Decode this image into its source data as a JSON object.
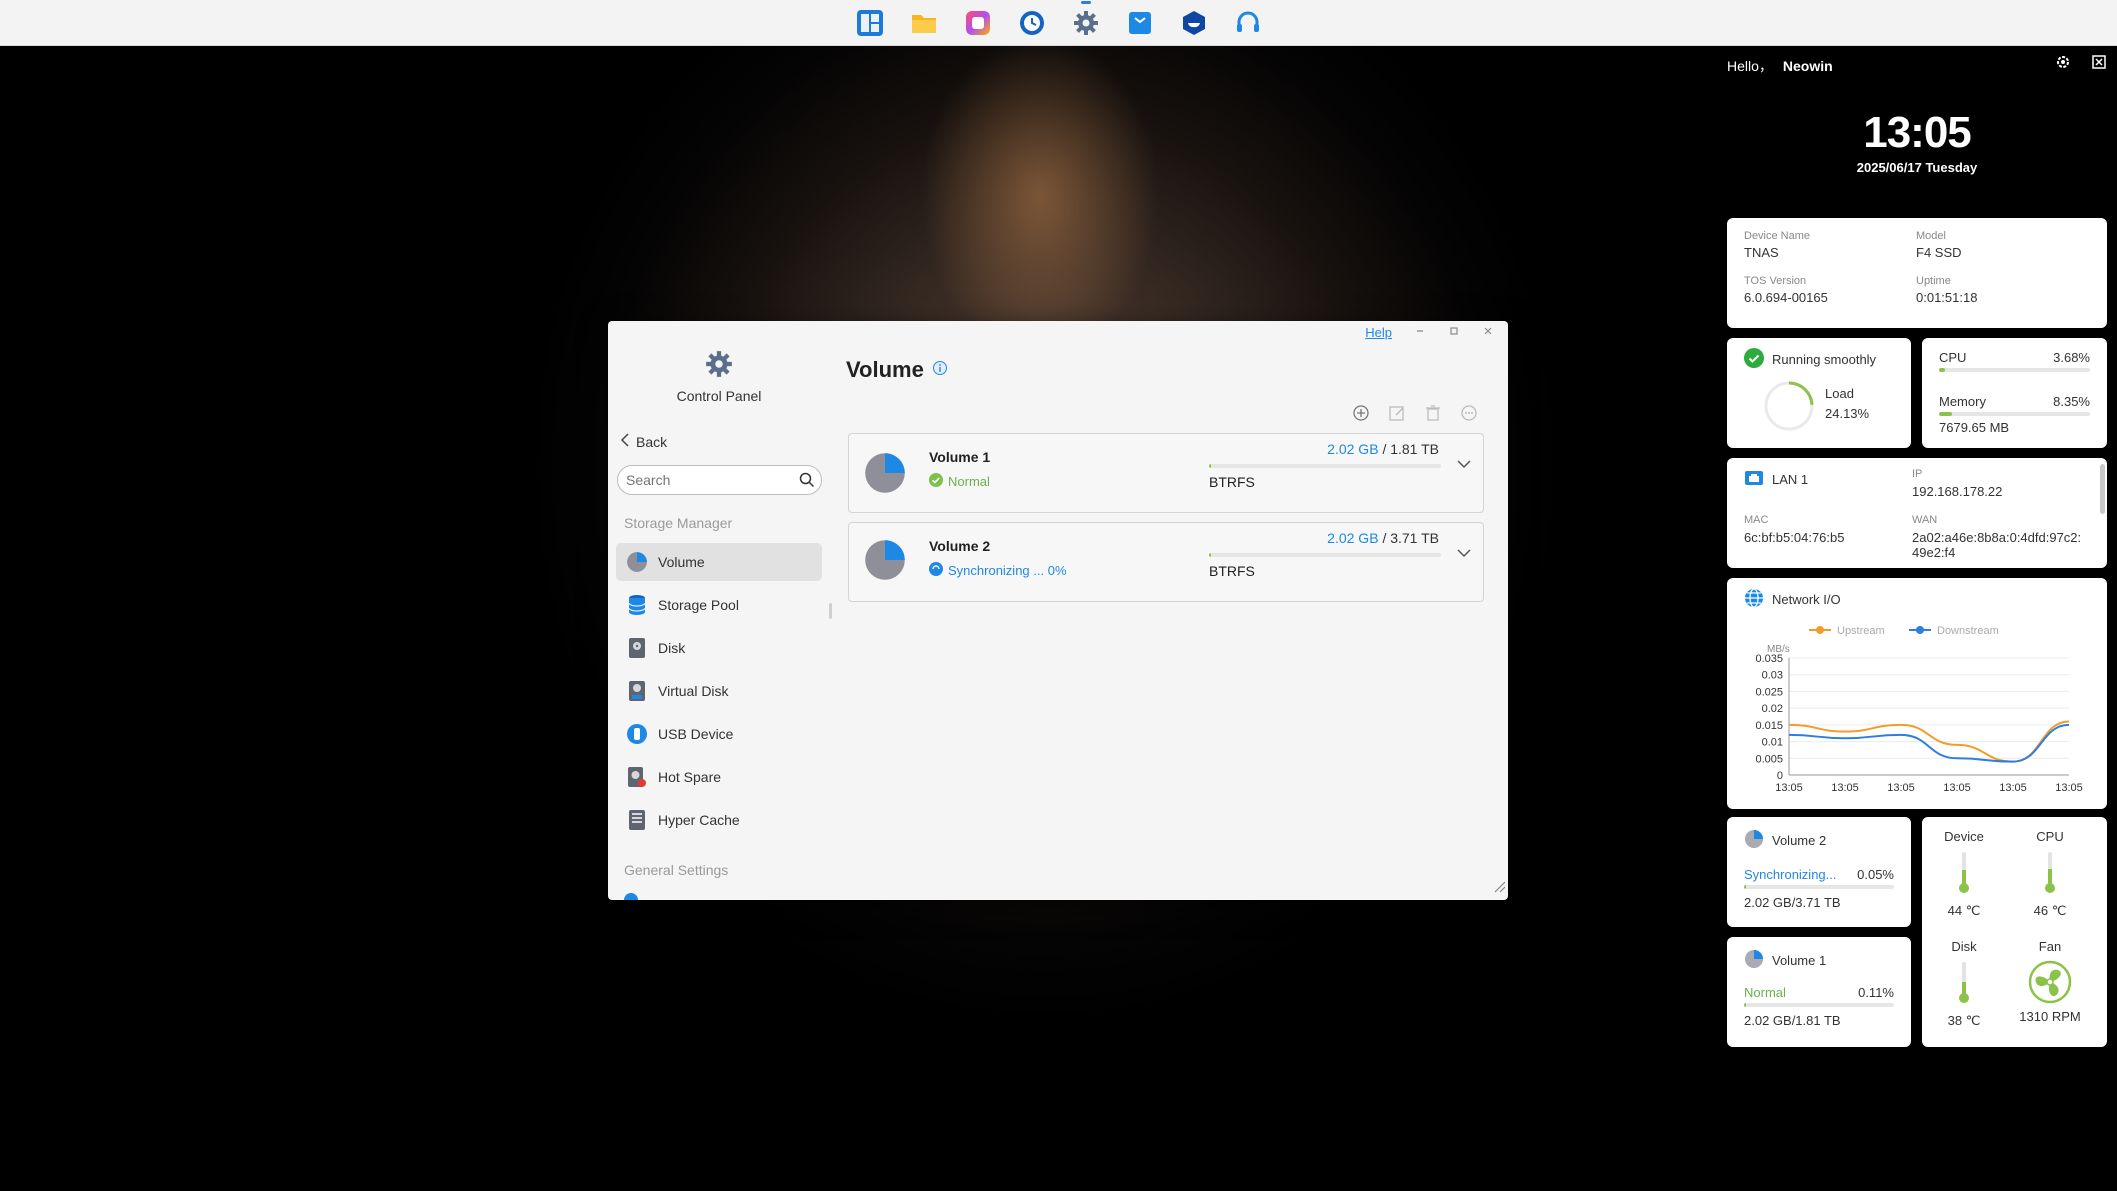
{
  "taskbar": {
    "icons": [
      "file-station-icon",
      "folder-icon",
      "photos-icon",
      "backup-clock-icon",
      "control-panel-gear-icon",
      "mail-bag-icon",
      "docker-icon",
      "support-headset-icon"
    ]
  },
  "widgets": {
    "greeting": "Hello，",
    "user": "Neowin",
    "time": "13:05",
    "date": "2025/06/17 Tuesday",
    "device": {
      "name_label": "Device Name",
      "name": "TNAS",
      "model_label": "Model",
      "model": "F4 SSD",
      "tos_label": "TOS Version",
      "tos": "6.0.694-00165",
      "uptime_label": "Uptime",
      "uptime": "0:01:51:18"
    },
    "status": {
      "text": "Running smoothly",
      "load_label": "Load",
      "load": "24.13%",
      "load_value": 24.13
    },
    "resources": {
      "cpu_label": "CPU",
      "cpu": "3.68%",
      "cpu_value": 3.68,
      "mem_label": "Memory",
      "mem": "8.35%",
      "mem_value": 8.35,
      "mem_used": "7679.65 MB"
    },
    "lan": {
      "title": "LAN 1",
      "ip_label": "IP",
      "ip": "192.168.178.22",
      "mac_label": "MAC",
      "mac": "6c:bf:b5:04:76:b5",
      "wan_label": "WAN",
      "wan": "2a02:a46e:8b8a:0:4dfd:97c2:49e2:f4"
    },
    "network": {
      "title": "Network I/O"
    },
    "vol2": {
      "title": "Volume 2",
      "status": "Synchronizing...",
      "pct": "0.05%",
      "pct_value": 0.05,
      "size": "2.02 GB/3.71 TB"
    },
    "vol1": {
      "title": "Volume 1",
      "status": "Normal",
      "pct": "0.11%",
      "pct_value": 0.11,
      "size": "2.02 GB/1.81 TB"
    },
    "temps": {
      "device_label": "Device",
      "device": "44 ℃",
      "device_value": 44,
      "cpu_label": "CPU",
      "cpu": "46 ℃",
      "cpu_value": 46,
      "disk_label": "Disk",
      "disk": "38 ℃",
      "disk_value": 38,
      "fan_label": "Fan",
      "fan": "1310 RPM"
    }
  },
  "chart_data": {
    "type": "line",
    "title": "Network I/O",
    "ylabel": "MB/s",
    "ylim": [
      0,
      0.035
    ],
    "yticks": [
      "0.035",
      "0.03",
      "0.025",
      "0.02",
      "0.015",
      "0.01",
      "0.005",
      "0"
    ],
    "x": [
      "13:05",
      "13:05",
      "13:05",
      "13:05",
      "13:05",
      "13:05"
    ],
    "series": [
      {
        "name": "Upstream",
        "color": "#f39c26",
        "values": [
          0.015,
          0.013,
          0.015,
          0.009,
          0.004,
          0.016
        ]
      },
      {
        "name": "Downstream",
        "color": "#2f7de1",
        "values": [
          0.012,
          0.011,
          0.012,
          0.005,
          0.004,
          0.015
        ]
      }
    ]
  },
  "window": {
    "help": "Help",
    "app_title": "Control Panel",
    "back": "Back",
    "search_placeholder": "Search",
    "section1": "Storage Manager",
    "nav": [
      {
        "label": "Volume",
        "icon": "volume-pie-icon"
      },
      {
        "label": "Storage Pool",
        "icon": "storage-pool-icon"
      },
      {
        "label": "Disk",
        "icon": "disk-icon"
      },
      {
        "label": "Virtual Disk",
        "icon": "virtual-disk-icon"
      },
      {
        "label": "USB Device",
        "icon": "usb-icon"
      },
      {
        "label": "Hot Spare",
        "icon": "hot-spare-icon"
      },
      {
        "label": "Hyper Cache",
        "icon": "hyper-cache-icon"
      }
    ],
    "section2": "General Settings",
    "page_title": "Volume",
    "volumes": [
      {
        "name": "Volume 1",
        "status": "Normal",
        "used": "2.02 GB",
        "sep": "/",
        "total": "1.81 TB",
        "fs": "BTRFS",
        "usage": 0.11
      },
      {
        "name": "Volume 2",
        "status": "Synchronizing ... 0%",
        "used": "2.02 GB",
        "sep": "/",
        "total": "3.71 TB",
        "fs": "BTRFS",
        "usage": 0.05
      }
    ]
  }
}
